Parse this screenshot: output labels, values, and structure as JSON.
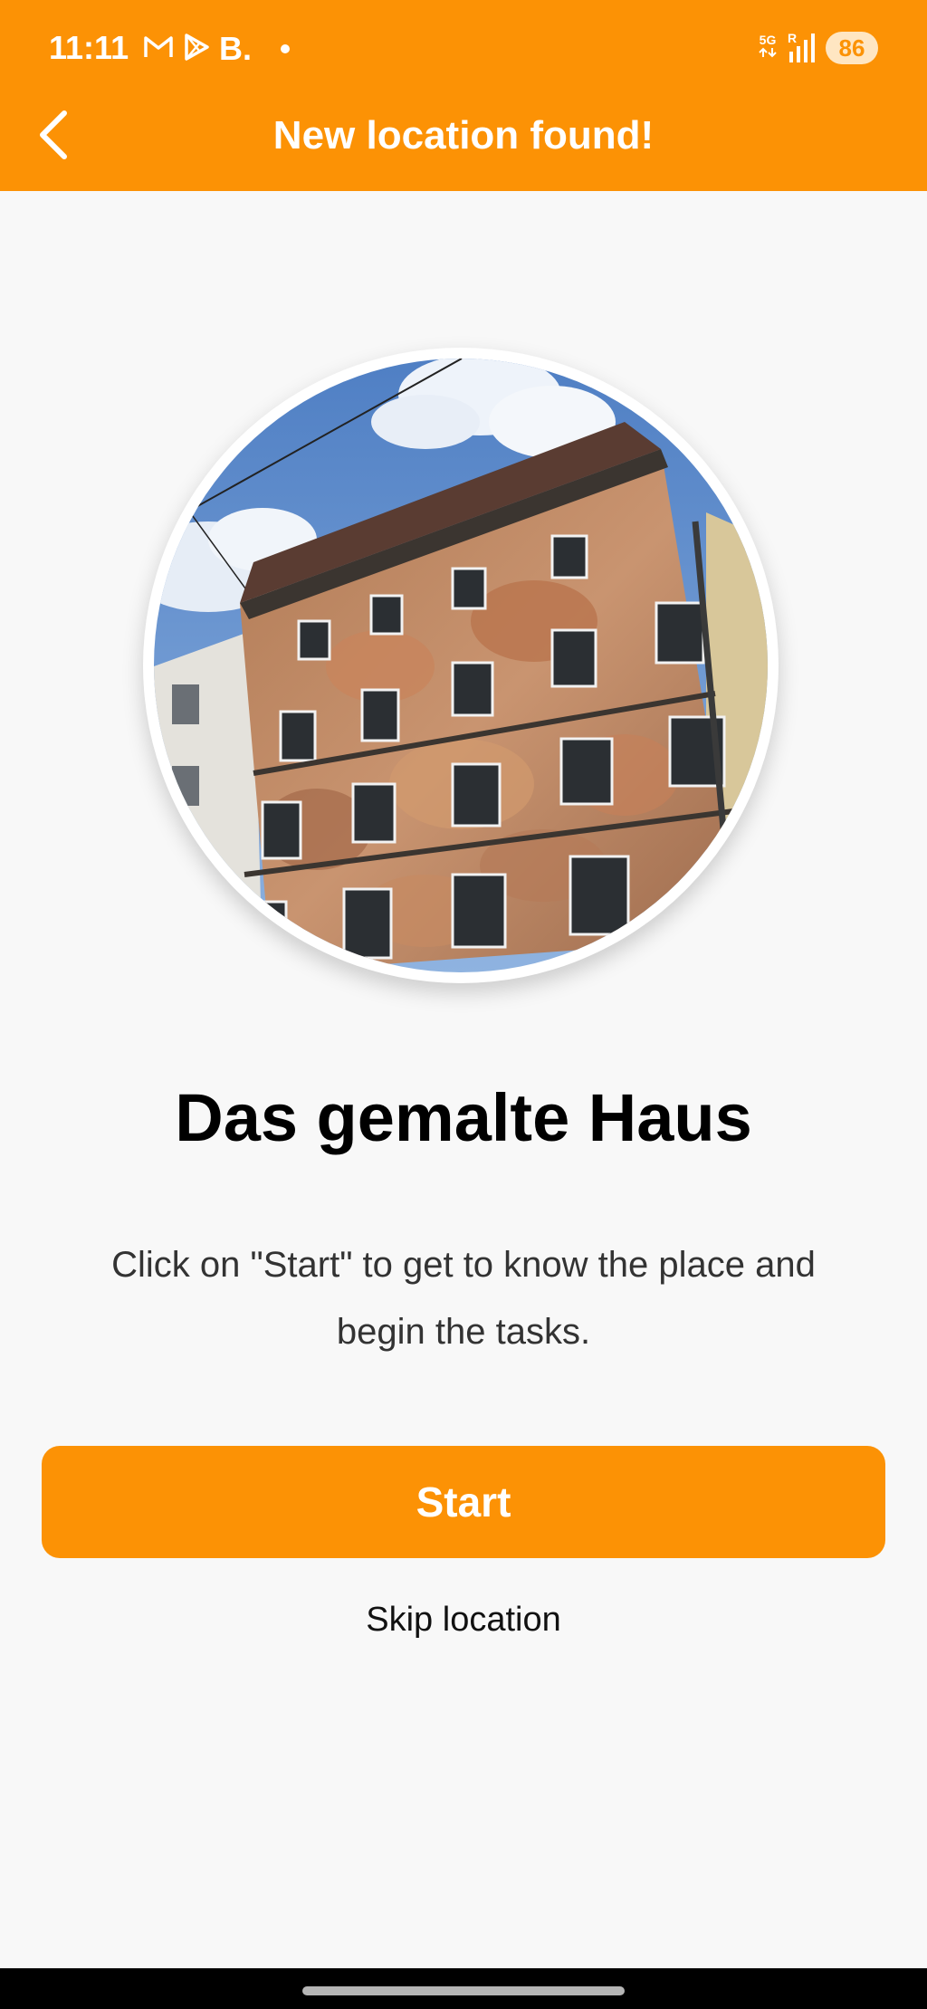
{
  "status_bar": {
    "time": "11:11",
    "app_letter": "B.",
    "network": "5G",
    "roaming": "R",
    "battery": "86"
  },
  "app_bar": {
    "title": "New location found!"
  },
  "location": {
    "name": "Das gemalte Haus",
    "description": "Click on \"Start\" to get to know the place and begin the tasks."
  },
  "actions": {
    "start_label": "Start",
    "skip_label": "Skip location"
  },
  "colors": {
    "accent": "#fc9205",
    "background": "#f8f8f8"
  }
}
